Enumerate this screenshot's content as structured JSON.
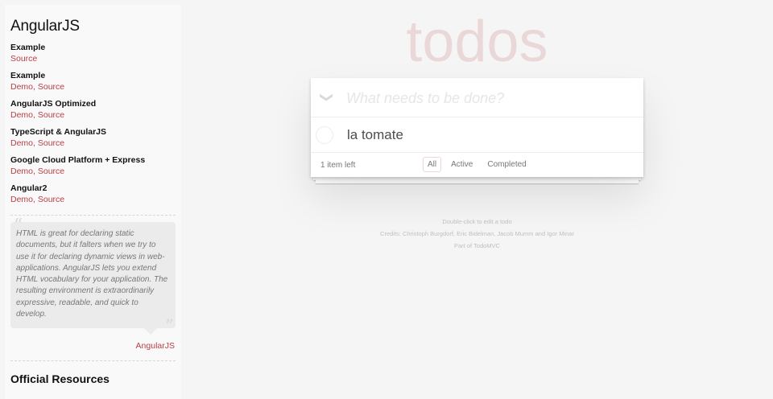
{
  "sidebar": {
    "title": "AngularJS",
    "examples": [
      {
        "name": "Example",
        "links": [
          "Source"
        ]
      },
      {
        "name": "Example",
        "links": [
          "Demo",
          "Source"
        ]
      },
      {
        "name": "AngularJS Optimized",
        "links": [
          "Demo",
          "Source"
        ]
      },
      {
        "name": "TypeScript & AngularJS",
        "links": [
          "Demo",
          "Source"
        ]
      },
      {
        "name": "Google Cloud Platform + Express",
        "links": [
          "Demo",
          "Source"
        ]
      },
      {
        "name": "Angular2",
        "links": [
          "Demo",
          "Source"
        ]
      }
    ],
    "quote": "HTML is great for declaring static documents, but it falters when we try to use it for declaring dynamic views in web-applications. AngularJS lets you extend HTML vocabulary for your application. The resulting environment is extraordinarily expressive, readable, and quick to develop.",
    "quote_author": "AngularJS",
    "resources_title": "Official Resources"
  },
  "app": {
    "title": "todos",
    "new_todo_placeholder": "What needs to be done?",
    "toggle_all_glyph": "❯",
    "todos": [
      {
        "title": "la tomate",
        "completed": false
      }
    ],
    "footer": {
      "count": "1 item left",
      "filters": [
        "All",
        "Active",
        "Completed"
      ],
      "selected_filter": "All"
    }
  },
  "info": {
    "line1": "Double-click to edit a todo",
    "line2": "Credits: Christoph Burgdorf, Eric Bidelman, Jacob Mumm and Igor Minar",
    "line3": "Part of TodoMVC"
  },
  "colors": {
    "accent": "#b83f45",
    "title": "rgba(175,47,47,0.15)",
    "background": "#f5f5f5"
  }
}
